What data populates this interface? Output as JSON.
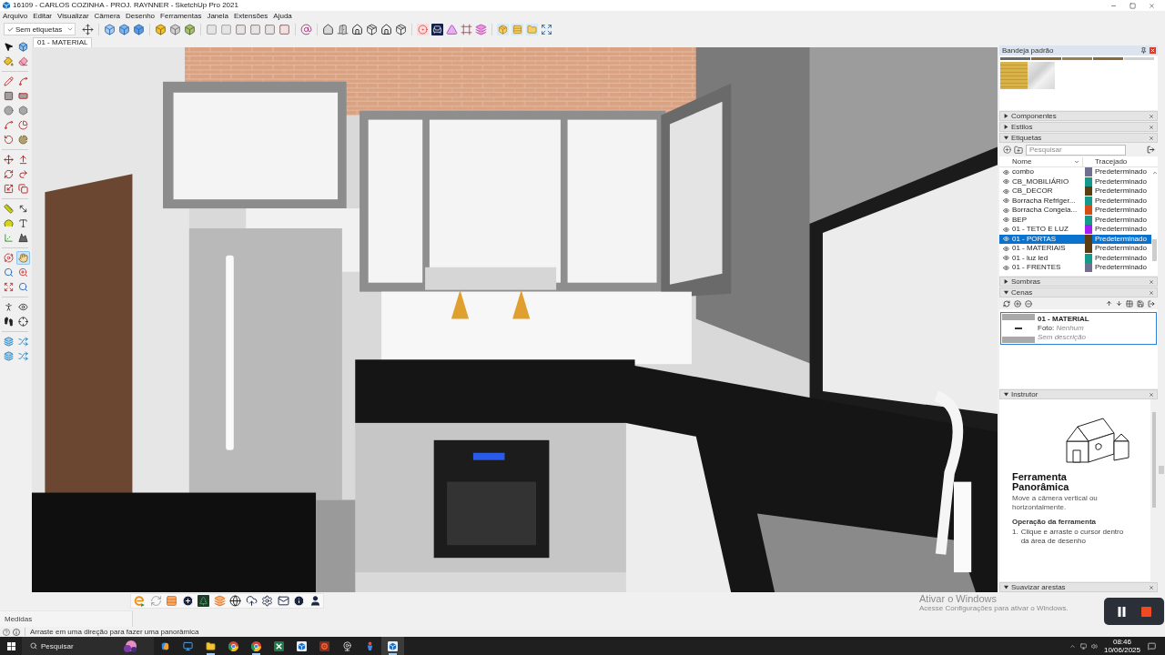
{
  "window": {
    "title": "16109 - CARLOS COZINHA - PROJ. RAYNNER - SketchUp Pro 2021"
  },
  "menu": [
    "Arquivo",
    "Editar",
    "Visualizar",
    "Câmera",
    "Desenho",
    "Ferramentas",
    "Janela",
    "Extensões",
    "Ajuda"
  ],
  "toolbar": {
    "tag_filter": {
      "value": "Sem etiquetas",
      "checked": true
    }
  },
  "scene_tabs": [
    {
      "label": "01 - MATERIAL",
      "selected": true
    }
  ],
  "tool_palette": [
    {
      "selected": false
    },
    {
      "selected": false
    },
    {
      "selected": false
    },
    {
      "selected": false
    },
    {
      "selected": false
    },
    {
      "selected": false
    },
    {
      "selected": false
    },
    {
      "selected": false
    },
    {
      "selected": false
    },
    {
      "selected": false
    },
    {
      "selected": false
    },
    {
      "selected": false
    },
    {
      "selected": false
    },
    {
      "selected": false
    },
    {
      "selected": false
    },
    {
      "selected": false
    },
    {
      "selected": false
    },
    {
      "selected": false
    },
    {
      "selected": false
    },
    {
      "selected": false
    },
    {
      "selected": false
    },
    {
      "selected": false
    },
    {
      "selected": false
    },
    {
      "selected": false
    },
    {
      "selected": false
    },
    {
      "selected": false
    },
    {
      "selected": false
    },
    {
      "selected": true
    },
    {
      "selected": false
    },
    {
      "selected": false
    },
    {
      "selected": false
    },
    {
      "selected": false
    },
    {
      "selected": false
    },
    {
      "selected": false
    },
    {
      "selected": false
    },
    {
      "selected": false
    },
    {
      "selected": false
    },
    {
      "selected": false
    },
    {
      "selected": false
    },
    {
      "selected": false
    }
  ],
  "tray": {
    "title": "Bandeja padrão",
    "sections": [
      {
        "kind": "panel",
        "title": "Componentes",
        "expanded": false
      },
      {
        "kind": "panel",
        "title": "Estilos",
        "expanded": false
      },
      {
        "kind": "tags",
        "title": "Etiquetas",
        "expanded": true,
        "search_placeholder": "Pesquisar",
        "columns": [
          "Nome",
          "Tracejado"
        ],
        "rows": [
          {
            "name": "combo",
            "color": "#70708e",
            "dash": "Predeterminado",
            "visible": true,
            "selected": false
          },
          {
            "name": "CB_MOBILIÁRIO",
            "color": "#16998a",
            "dash": "Predeterminado",
            "visible": true,
            "selected": false
          },
          {
            "name": "CB_DECOR",
            "color": "#5c3d12",
            "dash": "Predeterminado",
            "visible": true,
            "selected": false
          },
          {
            "name": "Borracha Refriger...",
            "color": "#16998a",
            "dash": "Predeterminado",
            "visible": true,
            "selected": false
          },
          {
            "name": "Borracha Congela...",
            "color": "#d64c12",
            "dash": "Predeterminado",
            "visible": true,
            "selected": false
          },
          {
            "name": "BEP",
            "color": "#16998a",
            "dash": "Predeterminado",
            "visible": true,
            "selected": false
          },
          {
            "name": "01 - TETO E LUZ",
            "color": "#a41ef0",
            "dash": "Predeterminado",
            "visible": true,
            "selected": false
          },
          {
            "name": "01 - PORTAS",
            "color": "#5c3d12",
            "dash": "Predeterminado",
            "visible": true,
            "selected": true
          },
          {
            "name": "01 - MATERIAIS",
            "color": "#5c3d12",
            "dash": "Predeterminado",
            "visible": true,
            "selected": false
          },
          {
            "name": "01 - luz led",
            "color": "#16998a",
            "dash": "Predeterminado",
            "visible": true,
            "selected": false
          },
          {
            "name": "01 - FRENTES",
            "color": "#70708e",
            "dash": "Predeterminado",
            "visible": true,
            "selected": false
          }
        ]
      },
      {
        "kind": "panel",
        "title": "Sombras",
        "expanded": false
      },
      {
        "kind": "scenes",
        "title": "Cenas",
        "expanded": true,
        "scenes": [
          {
            "name": "01 - MATERIAL",
            "photo_label": "Foto:",
            "photo_value": "Nenhum",
            "description": "Sem descrição",
            "selected": true
          }
        ]
      },
      {
        "kind": "instructor",
        "title": "Instrutor",
        "expanded": true,
        "tool_name": "Ferramenta Panorâmica",
        "summary": "Move a câmera vertical ou horizontalmente.",
        "heading": "Operação da ferramenta",
        "steps": [
          {
            "number": "1.",
            "text": "Clique e arraste o cursor dentro da área de desenho"
          }
        ]
      },
      {
        "kind": "panel",
        "title": "Suavizar arestas",
        "expanded": true
      }
    ]
  },
  "measurements": {
    "label": "Medidas"
  },
  "status_bar": {
    "text": "Arraste em uma direção para fazer uma panorâmica"
  },
  "activation_notice": {
    "title": "Ativar o Windows",
    "text": "Acesse Configurações para ativar o Windows."
  },
  "taskbar": {
    "search_placeholder": "Pesquisar",
    "apps": [
      {
        "selected": false,
        "running": false
      },
      {
        "selected": false,
        "running": false
      },
      {
        "selected": false,
        "running": true
      },
      {
        "selected": false,
        "running": false
      },
      {
        "selected": false,
        "running": true
      },
      {
        "selected": false,
        "running": false
      },
      {
        "selected": false,
        "running": false
      },
      {
        "selected": false,
        "running": false
      },
      {
        "selected": false,
        "running": false
      },
      {
        "selected": false,
        "running": false
      },
      {
        "selected": true,
        "running": true
      }
    ],
    "time": "08:46",
    "date": "10/06/2025"
  }
}
